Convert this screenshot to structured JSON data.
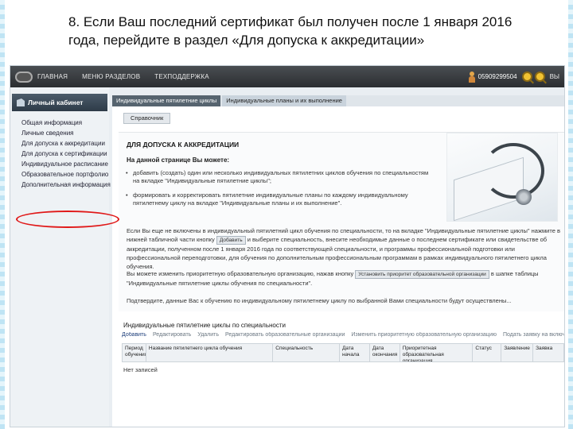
{
  "slide": {
    "caption": "8.  Если Ваш последний сертификат был получен после 1 января 2016 года, перейдите в раздел «Для допуска к аккредитации»"
  },
  "topnav": {
    "items": [
      "ГЛАВНАЯ",
      "МЕНЮ РАЗДЕЛОВ",
      "ТЕХПОДДЕРЖКА"
    ],
    "user_id": "05909299504",
    "tail": "ВЫ"
  },
  "sidebar": {
    "title": "Личный кабинет",
    "items": [
      "Общая информация",
      "Личные сведения",
      "Для допуска к аккредитации",
      "Для допуска к сертификации",
      "Индивидуальное расписание",
      "Образовательное портфолио",
      "Дополнительная информация"
    ]
  },
  "tabs": [
    "Индивидуальные пятилетние циклы",
    "Индивидуальные планы и их выполнение"
  ],
  "reference_button": "Справочник",
  "panel": {
    "title": "ДЛЯ ДОПУСКА К АККРЕДИТАЦИИ",
    "subtitle": "На данной странице Вы можете:",
    "bullet1": "добавить (создать) один или несколько индивидуальных пятилетних циклов обучения по специальностям на вкладке \"Индивидуальные пятилетние циклы\";",
    "bullet2": "формировать и корректировать пятилетние индивидуальные планы по каждому индивидуальному пятилетнему циклу на вкладке \"Индивидуальные планы и их выполнение\".",
    "para1": "Если Вы еще не включены в индивидуальный пятилетний цикл обучения по специальности, то на вкладке \"Индивидуальные пятилетние циклы\" нажмите в нижней табличной части кнопку",
    "add_button": "Добавить",
    "para1b": "и выберите специальность, внесите необходимые данные о последнем сертификате или свидетельстве об аккредитации, полученном после 1 января 2016 года по соответствующей специальности, и программы профессиональной подготовки или профессиональной переподготовки, для обучения по дополнительным профессиональным программам в рамках индивидуального пятилетнего цикла обучения.",
    "para2": "Вы можете изменить приоритетную образовательную организацию, нажав кнопку",
    "change_button": "Установить приоритет образовательной организации",
    "para2b": "в шапке таблицы \"Индивидуальные пятилетние циклы обучения по специальности\".",
    "para3": "Подтвердите, данные Вас к обучению по индивидуальному пятилетнему циклу по выбранной Вами специальности будут осуществлены..."
  },
  "lower": {
    "title": "Индивидуальные пятилетние циклы по специальности",
    "toolbar": [
      "Добавить",
      "Редактировать",
      "Удалить",
      "Редактировать образовательные организации",
      "Изменить приоритетную образовательную организацию",
      "Подать заявку на включение в пятилетний цикл"
    ],
    "columns": [
      "Период обучения",
      "Название пятилетнего цикла обучения",
      "Специальность",
      "Дата начала",
      "Дата окончания",
      "Приоритетная образовательная организация",
      "Статус",
      "Заявление",
      "Заявка"
    ],
    "empty": "Нет записей"
  }
}
